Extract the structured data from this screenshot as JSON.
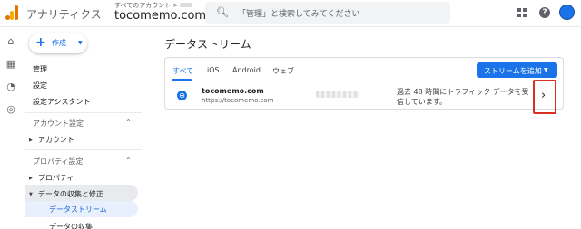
{
  "header": {
    "app_name": "アナリティクス",
    "account_crumb": "すべてのアカウント >",
    "property_name": "tocomemo.com",
    "search_placeholder": "「管理」と検索してみてください"
  },
  "sidebar": {
    "create_label": "作成",
    "items": [
      "管理",
      "設定",
      "設定アシスタント"
    ],
    "account_section": "アカウント設定",
    "account_item": "アカウント",
    "property_section": "プロパティ設定",
    "property_item": "プロパティ",
    "data_group": "データの収集と修正",
    "active_item": "データストリーム",
    "next_item": "データの収集"
  },
  "main": {
    "title": "データストリーム",
    "tabs": [
      "すべて",
      "iOS",
      "Android",
      "ウェブ"
    ],
    "add_stream_label": "ストリームを追加",
    "stream": {
      "name": "tocomemo.com",
      "url": "https://tocomemo.com",
      "status": "過去 48 時間にトラフィック データを受信しています。"
    }
  },
  "colors": {
    "accent": "#1a73e8",
    "highlight_box": "#d93025",
    "active_bg": "#e8f0fe"
  }
}
